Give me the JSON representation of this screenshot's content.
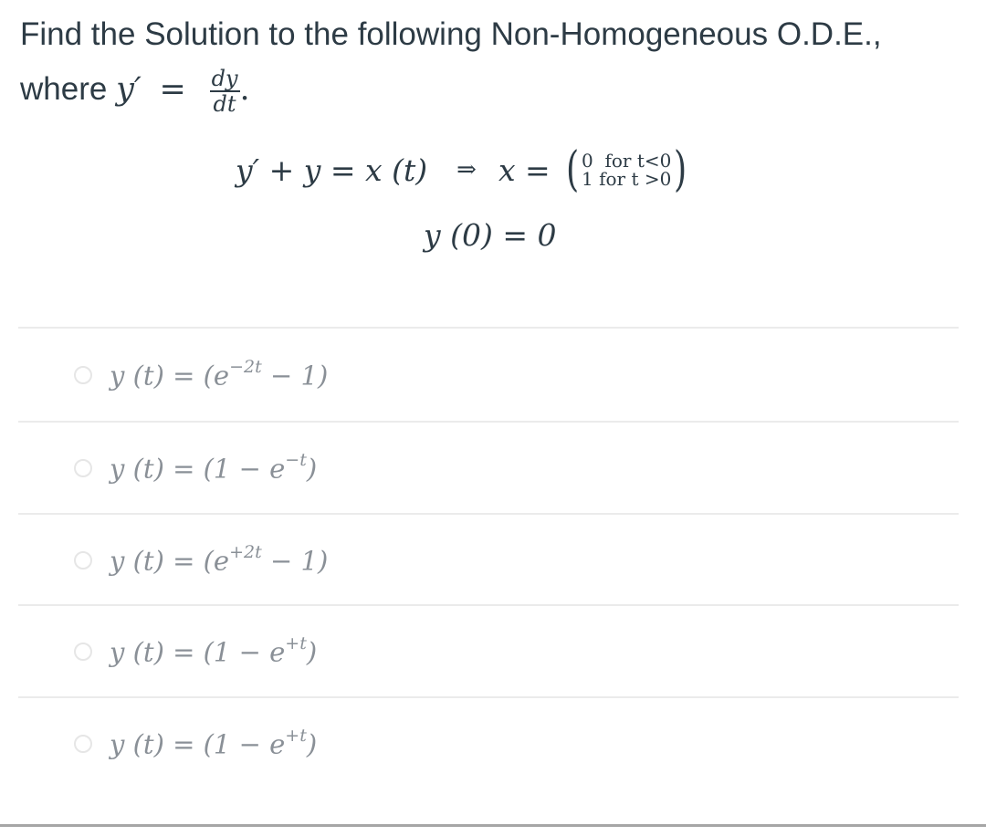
{
  "question": {
    "prompt_line1": "Find the Solution to the following Non-Homogeneous O.D.E.,",
    "prompt_where": "where",
    "prompt_yprime": "y′",
    "prompt_equals": "=",
    "frac_num": "dy",
    "frac_den": "dt",
    "prompt_period": ".",
    "equation_lhs": "y′ + y = x (t)",
    "implies": "⇒",
    "x_equals": "x =",
    "piecewise": {
      "row1": "0  for t<0",
      "row2": "1 for t >0"
    },
    "initial_condition": "y (0) = 0"
  },
  "answers": [
    {
      "base": "y (t) = (e",
      "sup": "−2t",
      "tail": " − 1)",
      "selected": false
    },
    {
      "base": "y (t) = (1 − e",
      "sup": "−t",
      "tail": ")",
      "selected": false
    },
    {
      "base": "y (t) = (e",
      "sup": "+2t",
      "tail": " − 1)",
      "selected": false
    },
    {
      "base": "y (t) = (1 − e",
      "sup": "+t",
      "tail": ")",
      "selected": false
    },
    {
      "base": "y (t) = (1 − e",
      "sup": "+t",
      "tail": ")",
      "selected": false
    }
  ]
}
